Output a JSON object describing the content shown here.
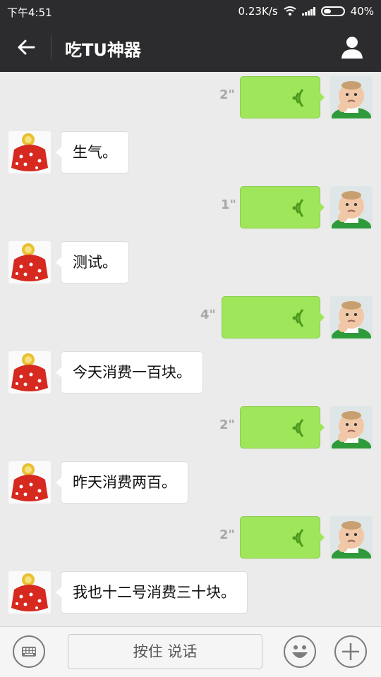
{
  "status_bar": {
    "time": "下午4:51",
    "net_speed": "0.23K/s",
    "battery": "40%",
    "battery_level": 0.4
  },
  "header": {
    "title": "吃TU神器",
    "icons": [
      "back-arrow-icon",
      "profile-icon"
    ]
  },
  "messages": [
    {
      "side": "me",
      "type": "voice",
      "duration": "2\""
    },
    {
      "side": "bot",
      "type": "text",
      "text": "生气。"
    },
    {
      "side": "me",
      "type": "voice",
      "duration": "1\""
    },
    {
      "side": "bot",
      "type": "text",
      "text": "测试。"
    },
    {
      "side": "me",
      "type": "voice",
      "duration": "4\""
    },
    {
      "side": "bot",
      "type": "text",
      "text": "今天消费一百块。"
    },
    {
      "side": "me",
      "type": "voice",
      "duration": "2\""
    },
    {
      "side": "bot",
      "type": "text",
      "text": "昨天消费两百。"
    },
    {
      "side": "me",
      "type": "voice",
      "duration": "2\""
    },
    {
      "side": "bot",
      "type": "text",
      "text": "我也十二号消费三十块。"
    }
  ],
  "input_bar": {
    "hold_to_talk": "按住 说话",
    "icons": [
      "keyboard-icon",
      "emoji-icon",
      "plus-icon"
    ]
  },
  "colors": {
    "bar_bg": "#2c2c2e",
    "chat_bg": "#ebebeb",
    "voice_bubble": "#9fe65a",
    "voice_wave": "#4c9a1e"
  }
}
